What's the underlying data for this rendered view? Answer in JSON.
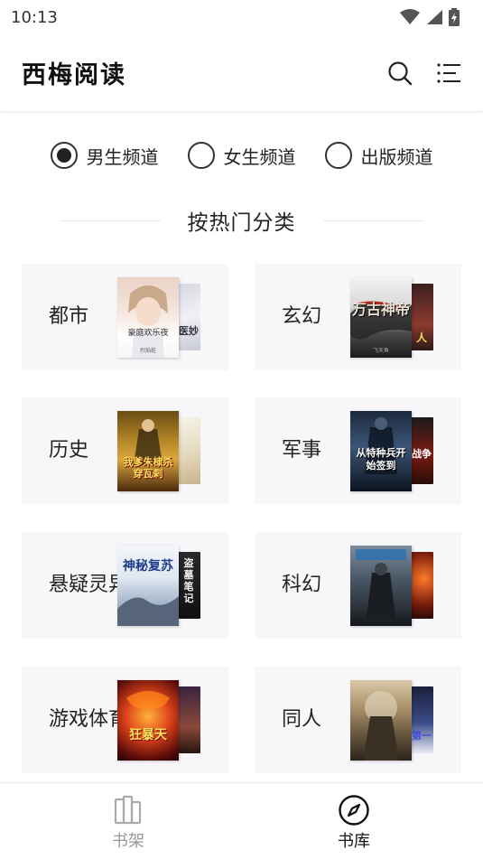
{
  "status_bar": {
    "time": "10:13"
  },
  "header": {
    "title": "西梅阅读",
    "icons": [
      "search-icon",
      "menu-icon"
    ]
  },
  "channels": [
    {
      "label": "男生频道",
      "selected": true
    },
    {
      "label": "女生频道",
      "selected": false
    },
    {
      "label": "出版频道",
      "selected": false
    }
  ],
  "section": {
    "title": "按热门分类"
  },
  "categories": [
    {
      "label": "都市",
      "cover_text": "豪庭欢乐夜",
      "cover_author": "烈焰乾",
      "back_text": "医妙"
    },
    {
      "label": "玄幻",
      "cover_text": "万古神帝",
      "cover_author": "飞天鱼",
      "back_text": "人"
    },
    {
      "label": "历史",
      "cover_text": "我爹朱棣杀穿瓦剌",
      "back_text": ""
    },
    {
      "label": "军事",
      "cover_text": "从特种兵开始签到",
      "back_text": "战争"
    },
    {
      "label": "悬疑灵异",
      "cover_text": "神秘复苏",
      "back_text": "盗墓笔记"
    },
    {
      "label": "科幻",
      "cover_text": "",
      "back_text": ""
    },
    {
      "label": "游戏体育",
      "cover_text": "狂暴天",
      "back_text": ""
    },
    {
      "label": "同人",
      "cover_text": "",
      "back_text": "第一"
    }
  ],
  "bottom_nav": [
    {
      "label": "书架",
      "active": false,
      "icon": "bookshelf-icon"
    },
    {
      "label": "书库",
      "active": true,
      "icon": "compass-icon"
    }
  ]
}
